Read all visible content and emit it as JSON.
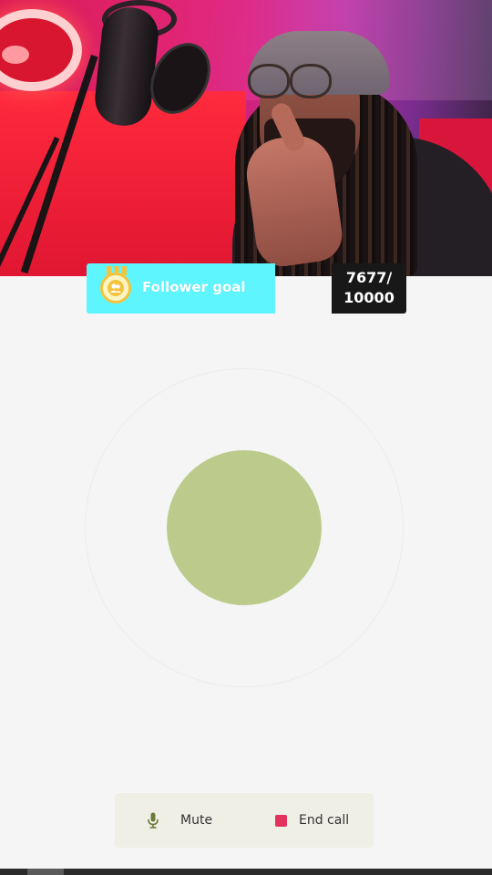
{
  "goal": {
    "label": "Follower goal",
    "current": "7677/",
    "target": "10000",
    "progress": 0.7677,
    "fill_color": "#5ef5ff",
    "icon": "people-icon"
  },
  "call": {
    "orb_color": "#bccb8c"
  },
  "controls": {
    "mute_label": "Mute",
    "mute_icon": "microphone-icon",
    "end_label": "End call",
    "end_color": "#e3325b"
  }
}
